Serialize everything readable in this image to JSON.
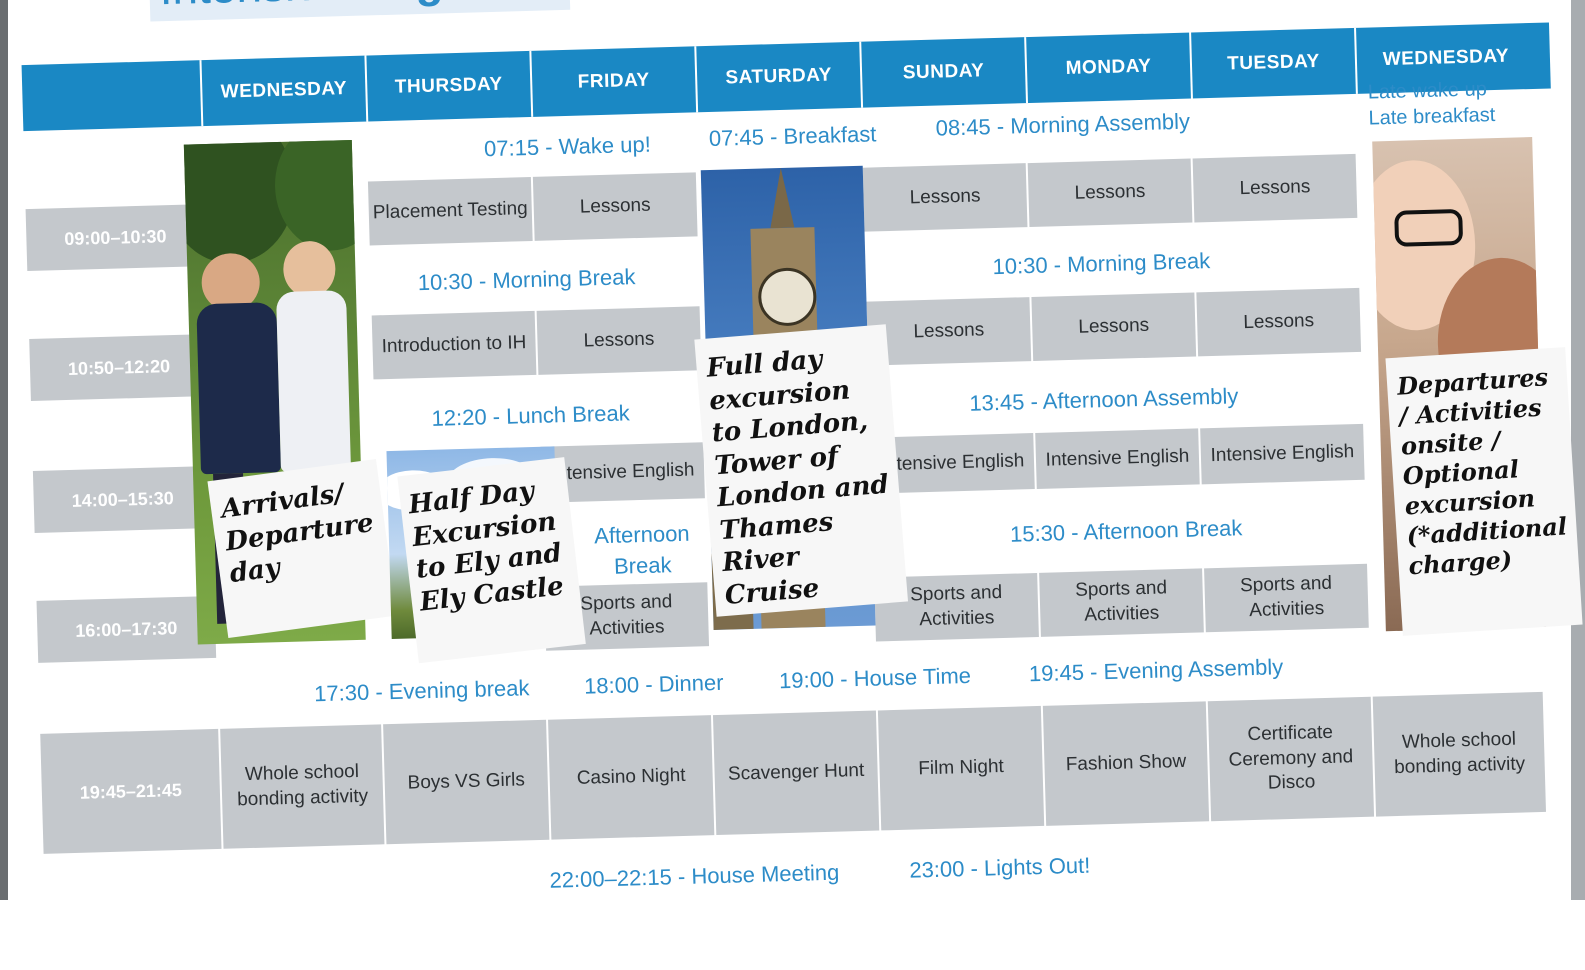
{
  "title": {
    "prefix": "Intensive ",
    "bold": "Eng"
  },
  "days": [
    "WEDNESDAY",
    "THURSDAY",
    "FRIDAY",
    "SATURDAY",
    "SUNDAY",
    "MONDAY",
    "TUESDAY",
    "WEDNESDAY"
  ],
  "times": {
    "t1": "09:00–10:30",
    "t2": "10:50–12:20",
    "t3": "14:00–15:30",
    "t4": "16:00–17:30",
    "t5": "19:45–21:45"
  },
  "bands": {
    "morning_line": "07:15 - Wake up!",
    "breakfast": "07:45 - Breakfast",
    "assembly": "08:45 - Morning Assembly",
    "late1": "Late wake up",
    "late2": "Late breakfast",
    "break_thu_fri": "10:30 - Morning Break",
    "break_sun_tue": "10:30 - Morning Break",
    "lunch": "12:20 - Lunch Break",
    "aft_assembly": "13:45 - Afternoon Assembly",
    "aft_break": "15:30 - Afternoon Break",
    "fri_aft_break": "Afternoon Break",
    "evening": "17:30 - Evening break",
    "dinner": "18:00 - Dinner",
    "house": "19:00 - House Time",
    "eve_assembly": "19:45 - Evening Assembly",
    "meeting": "22:00–22:15 - House Meeting",
    "lights": "23:00 - Lights Out!"
  },
  "cells": {
    "thu1": "Placement Testing",
    "fri1": "Lessons",
    "sun1": "Lessons",
    "mon1": "Lessons",
    "tue1": "Lessons",
    "thu2": "Introduction to IH",
    "fri2": "Lessons",
    "sun2": "Lessons",
    "mon2": "Lessons",
    "tue2": "Lessons",
    "fri3": "Intensive English",
    "sun3": "Intensive English",
    "mon3": "Intensive English",
    "tue3": "Intensive English",
    "fri4": "Sports and Activities",
    "sun4": "Sports and Activities",
    "mon4": "Sports and Activities",
    "tue4": "Sports and Activities",
    "ev_wed": "Whole school bonding activity",
    "ev_thu": "Boys VS Girls",
    "ev_fri": "Casino Night",
    "ev_sat": "Scavenger Hunt",
    "ev_sun": "Film Night",
    "ev_mon": "Fashion Show",
    "ev_tue": "Certificate Ceremony and Disco",
    "ev_wed2": "Whole school bonding activity"
  },
  "notes": {
    "wed": "Arrivals/ Departure day",
    "thu": "Half Day Excursion to Ely and Ely Castle",
    "sat": "Full day excursion to London, Tower of London and Thames River Cruise",
    "wed2": "Departures / Activities onsite / Optional excursion (*additional charge)"
  },
  "colors": {
    "accent": "#1a88c4",
    "band_text": "#2d8cc8",
    "cell_bg": "#c4c8cc"
  }
}
